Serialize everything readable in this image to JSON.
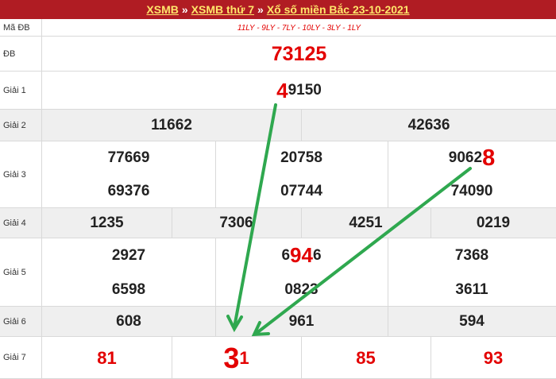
{
  "header": {
    "link1": "XSMB",
    "sep1": "»",
    "link2": "XSMB thứ 7",
    "sep2": "»",
    "link3": "Xổ số miền Bắc 23-10-2021"
  },
  "colors": {
    "header_bg": "#b01c23",
    "header_text": "#ffe66b",
    "accent_red": "#e30000",
    "arrow_green": "#2fa84f",
    "row_gray": "#efefef"
  },
  "rows": {
    "ma_db": {
      "label": "Mã ĐB",
      "value": "11LY - 9LY - 7LY - 10LY - 3LY - 1LY"
    },
    "db": {
      "label": "ĐB",
      "value": "73125"
    },
    "g1": {
      "label": "Giải 1",
      "hi": "4",
      "rest": "9150"
    },
    "g2": {
      "label": "Giải 2",
      "values": [
        "11662",
        "42636"
      ]
    },
    "g3": {
      "label": "Giải 3",
      "values": [
        "77669",
        "20758",
        "69376",
        "07744",
        "74090"
      ],
      "v3_plain": "9062",
      "v3_hi": "8"
    },
    "g4": {
      "label": "Giải 4",
      "values": [
        "1235",
        "7306",
        "4251",
        "0219"
      ]
    },
    "g5": {
      "label": "Giải 5",
      "values": [
        "2927",
        "7368",
        "6598",
        "0823",
        "3611"
      ],
      "v2_pre": "6",
      "v2_hi": "94",
      "v2_post": "6"
    },
    "g6": {
      "label": "Giải 6",
      "values": [
        "608",
        "961",
        "594"
      ]
    },
    "g7": {
      "label": "Giải 7",
      "values": [
        "81",
        "85",
        "93"
      ],
      "v2_hi": "3",
      "v2_post": "1"
    }
  },
  "annotation": {
    "arrow_count": 2,
    "arrow_icon": "green-arrow-icon"
  }
}
